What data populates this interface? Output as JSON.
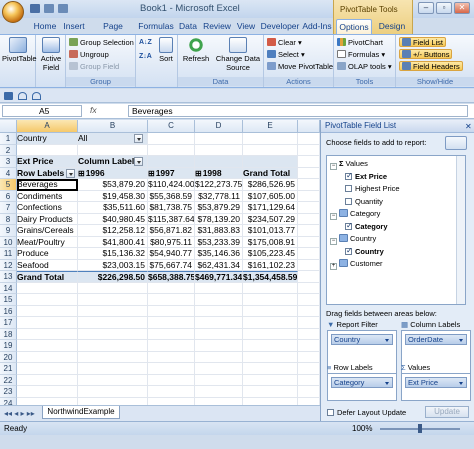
{
  "window": {
    "title": "Book1 - Microsoft Excel",
    "contextual_title": "PivotTable Tools",
    "minimize": "–",
    "restore": "▫",
    "close": "✕"
  },
  "tabs": [
    "Home",
    "Insert",
    "Page Layout",
    "Formulas",
    "Data",
    "Review",
    "View",
    "Developer",
    "Add-Ins",
    "Options",
    "Design"
  ],
  "active_tab": "Options",
  "ribbon": {
    "pivottable": {
      "label": "PivotTable",
      "group": ""
    },
    "active_field": {
      "label": "Active Field"
    },
    "group": {
      "group_selection": "Group Selection",
      "ungroup": "Ungroup",
      "group_field": "Group Field",
      "group_label": "Group"
    },
    "sort": {
      "label": "Sort"
    },
    "refresh": {
      "label": "Refresh"
    },
    "change_source": {
      "label": "Change Data Source",
      "group_label": "Data"
    },
    "actions": {
      "clear": "Clear",
      "select": "Select",
      "move": "Move PivotTable",
      "group_label": "Actions"
    },
    "tools": {
      "pivotchart": "PivotChart",
      "formulas": "Formulas",
      "olap": "OLAP tools",
      "group_label": "Tools"
    },
    "showhide": {
      "field_list": "Field List",
      "buttons": "+/- Buttons",
      "field_headers": "Field Headers",
      "group_label": "Show/Hide"
    }
  },
  "formula_bar": {
    "name_box": "A5",
    "fx": "fx",
    "value": "Beverages"
  },
  "columns": [
    "A",
    "B",
    "C",
    "D",
    "E"
  ],
  "rows": [
    "1",
    "2",
    "3",
    "4",
    "5",
    "6",
    "7",
    "8",
    "9",
    "10",
    "11",
    "12",
    "13",
    "14",
    "15",
    "16",
    "17",
    "18",
    "19",
    "20",
    "21",
    "22",
    "23",
    "24"
  ],
  "sheet": {
    "filter_label": "Country",
    "filter_value": "All",
    "values_caption": "Ext Price",
    "column_labels": "Column Labels",
    "row_labels": "Row Labels",
    "years": [
      "1996",
      "1997",
      "1998"
    ],
    "grand_total": "Grand Total",
    "data_rows": [
      {
        "label": "Beverages",
        "v": [
          "$53,879.20",
          "$110,424.00",
          "$122,273.75",
          "$286,526.95"
        ]
      },
      {
        "label": "Condiments",
        "v": [
          "$19,458.30",
          "$55,368.59",
          "$32,778.11",
          "$107,605.00"
        ]
      },
      {
        "label": "Confections",
        "v": [
          "$35,511.60",
          "$81,738.75",
          "$53,879.29",
          "$171,129.64"
        ]
      },
      {
        "label": "Dairy Products",
        "v": [
          "$40,980.45",
          "$115,387.64",
          "$78,139.20",
          "$234,507.29"
        ]
      },
      {
        "label": "Grains/Cereals",
        "v": [
          "$12,258.12",
          "$56,871.82",
          "$31,883.83",
          "$101,013.77"
        ]
      },
      {
        "label": "Meat/Poultry",
        "v": [
          "$41,800.41",
          "$80,975.11",
          "$53,233.39",
          "$175,008.91"
        ]
      },
      {
        "label": "Produce",
        "v": [
          "$15,136.32",
          "$54,940.77",
          "$35,146.36",
          "$105,223.45"
        ]
      },
      {
        "label": "Seafood",
        "v": [
          "$23,003.15",
          "$75,667.74",
          "$62,431.34",
          "$161,102.23"
        ]
      }
    ],
    "grand_row": {
      "label": "Grand Total",
      "v": [
        "$226,298.50",
        "$658,388.75",
        "$469,771.34",
        "$1,354,458.59"
      ]
    }
  },
  "sheet_tab": "NorthwindExample",
  "status": {
    "ready": "Ready",
    "zoom": "100%"
  },
  "panel": {
    "title": "PivotTable Field List",
    "choose": "Choose fields to add to report:",
    "fields": [
      {
        "label": "Values",
        "kind": "sigma"
      },
      {
        "label": "Ext Price",
        "kind": "checked",
        "bold": true
      },
      {
        "label": "Highest Price",
        "kind": "unchecked"
      },
      {
        "label": "Quantity",
        "kind": "unchecked"
      },
      {
        "label": "Category",
        "kind": "table"
      },
      {
        "label": "Category",
        "kind": "checked",
        "bold": true
      },
      {
        "label": "Country",
        "kind": "table"
      },
      {
        "label": "Country",
        "kind": "checked",
        "bold": true
      },
      {
        "label": "Customer",
        "kind": "table"
      }
    ],
    "drag": "Drag fields between areas below:",
    "report_filter": "Report Filter",
    "column_labels": "Column Labels",
    "row_labels": "Row Labels",
    "values": "Values",
    "chip_filter": "Country",
    "chip_columns": "OrderDate",
    "chip_rows": "Category",
    "chip_values": "Ext Price",
    "defer": "Defer Layout Update",
    "update": "Update"
  }
}
